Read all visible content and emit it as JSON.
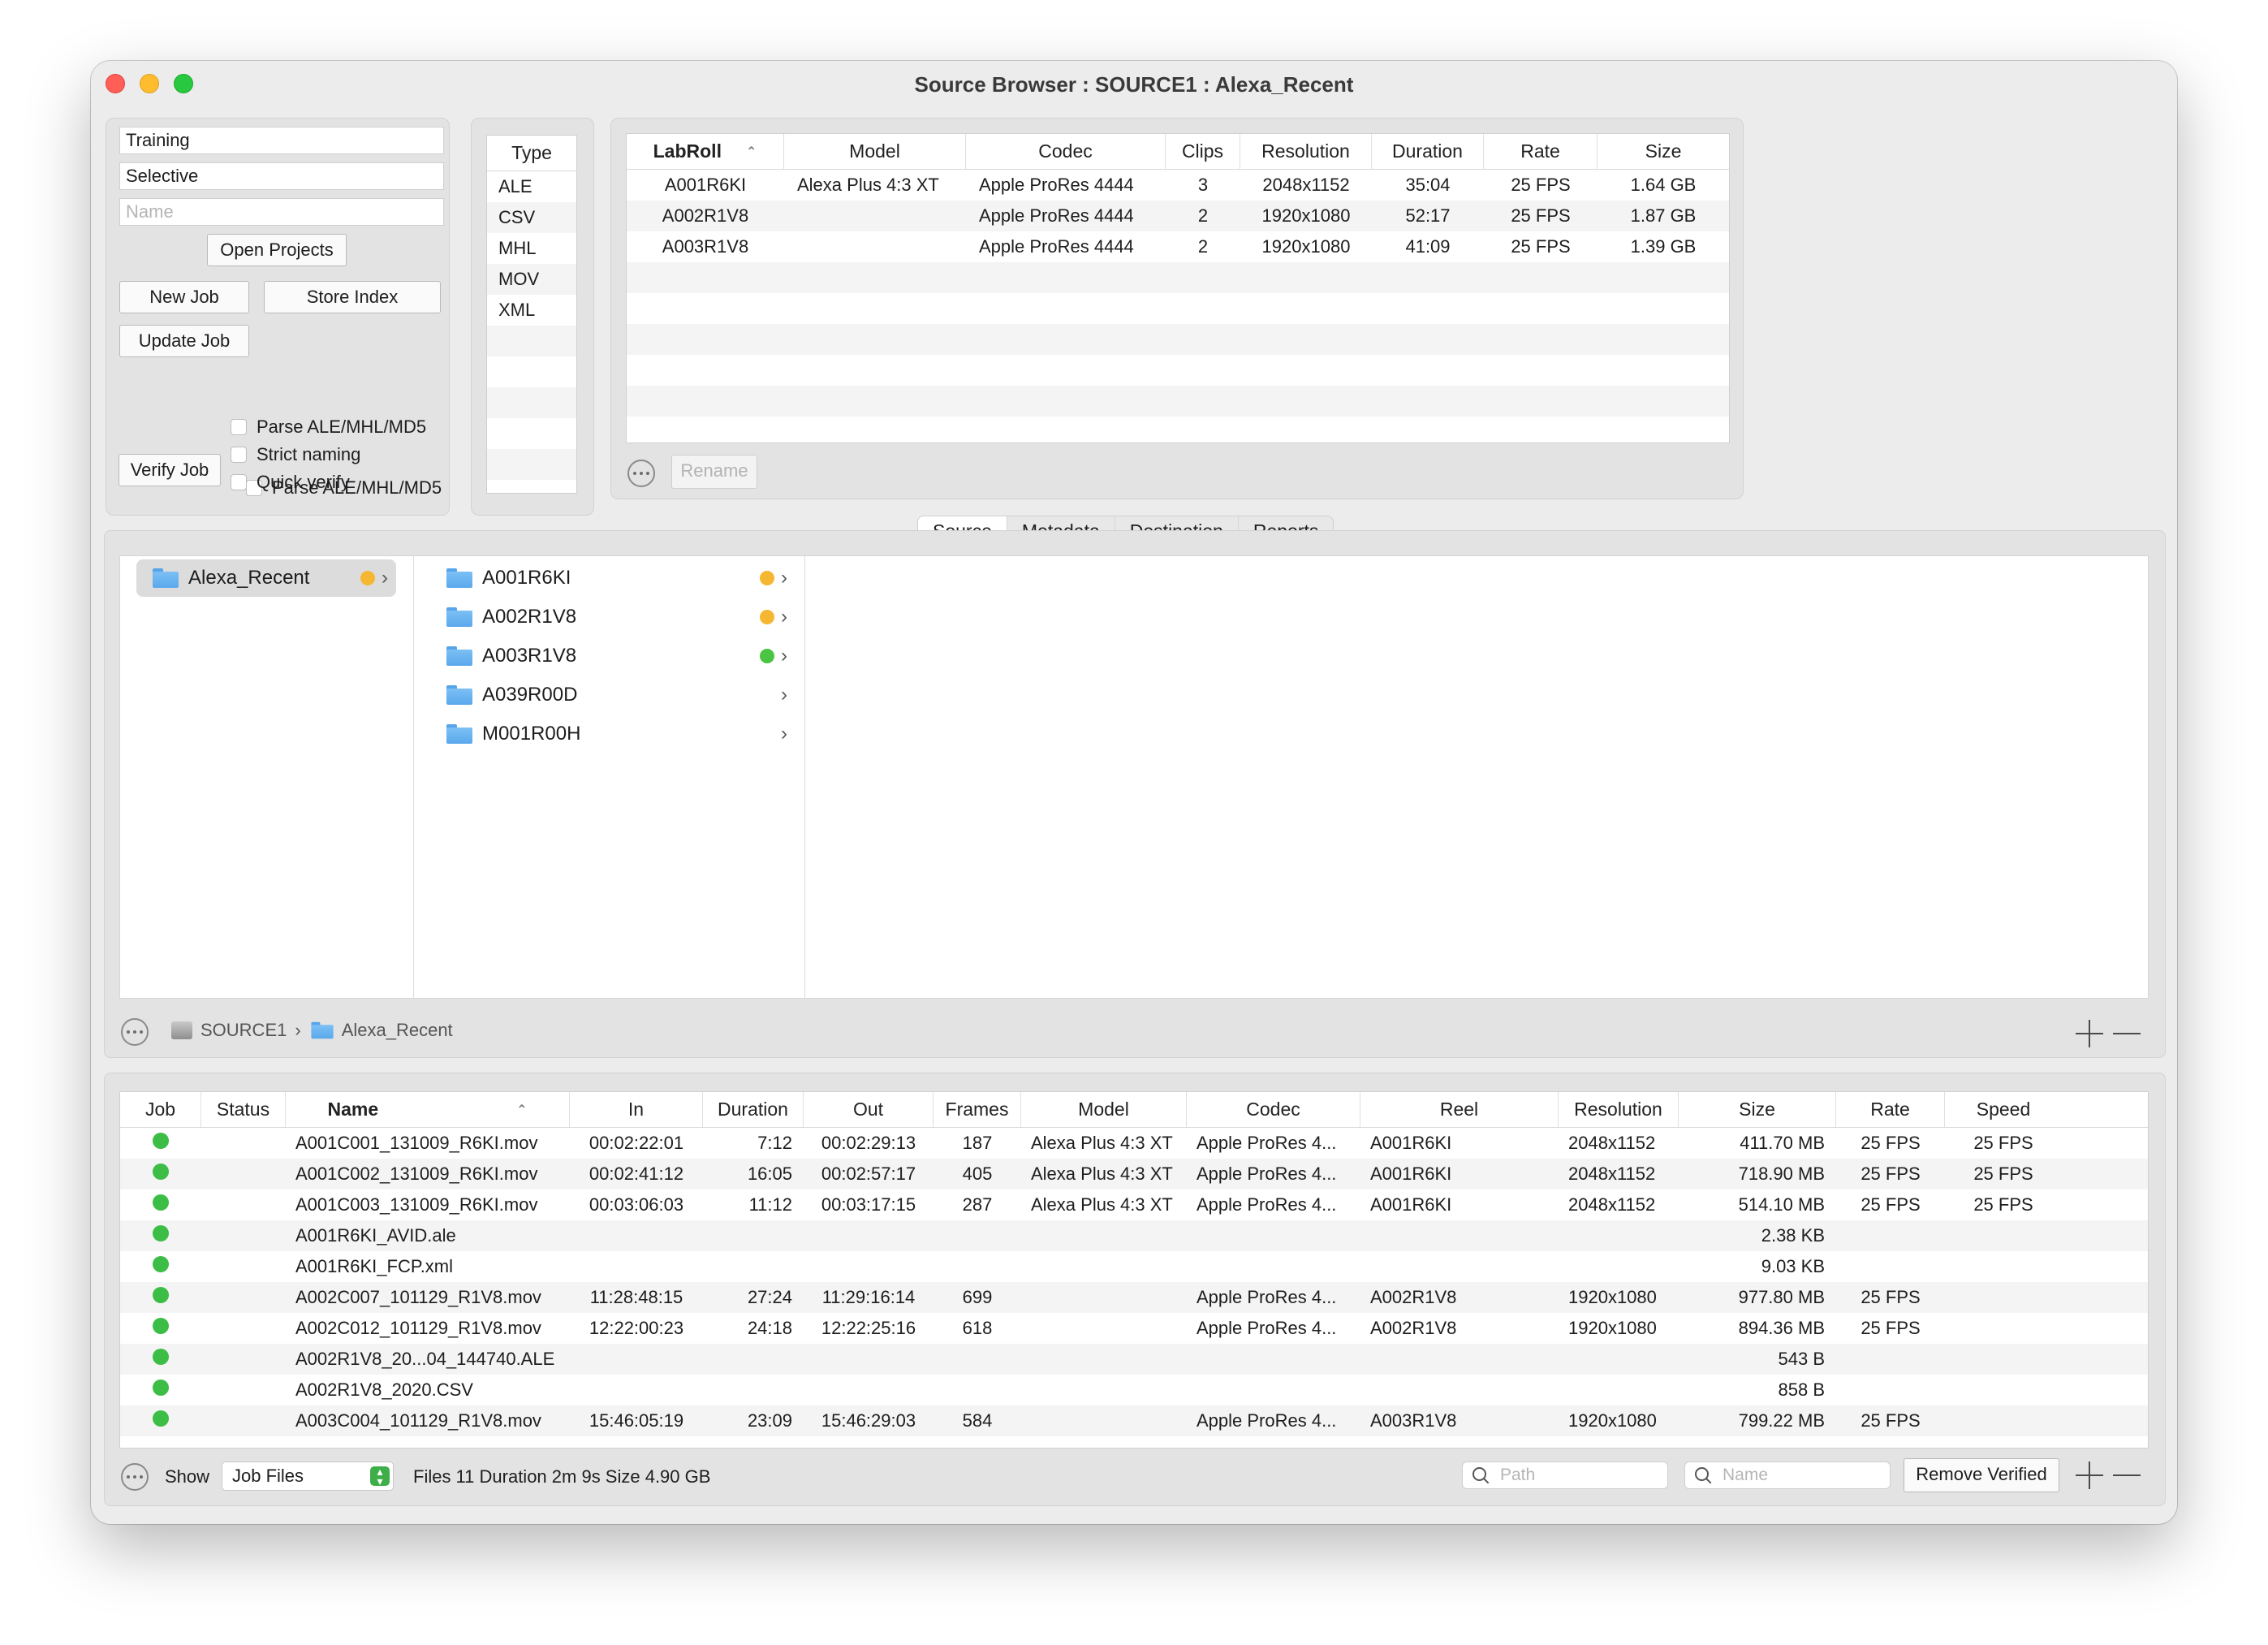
{
  "window": {
    "title": "Source Browser : SOURCE1 : Alexa_Recent"
  },
  "project": {
    "field1": "Training",
    "field2": "Selective",
    "name_placeholder": "Name",
    "open_projects": "Open Projects",
    "new_job": "New Job",
    "store_index": "Store Index",
    "update_job": "Update Job",
    "verify_job": "Verify Job",
    "options": [
      "Parse ALE/MHL/MD5",
      "Strict naming",
      "Quick verify"
    ]
  },
  "types": {
    "header": "Type",
    "items": [
      "ALE",
      "CSV",
      "MHL",
      "MOV",
      "XML"
    ]
  },
  "rolls": {
    "columns": [
      "LabRoll",
      "Model",
      "Codec",
      "Clips",
      "Resolution",
      "Duration",
      "Rate",
      "Size"
    ],
    "rows": [
      [
        "A001R6KI",
        "Alexa Plus 4:3 XT",
        "Apple ProRes 4444",
        "3",
        "2048x1152",
        "35:04",
        "25 FPS",
        "1.64 GB"
      ],
      [
        "A002R1V8",
        "",
        "Apple ProRes 4444",
        "2",
        "1920x1080",
        "52:17",
        "25 FPS",
        "1.87 GB"
      ],
      [
        "A003R1V8",
        "",
        "Apple ProRes 4444",
        "2",
        "1920x1080",
        "41:09",
        "25 FPS",
        "1.39 GB"
      ]
    ],
    "rename": "Rename"
  },
  "tabs": [
    "Source",
    "Metadata",
    "Destination",
    "Reports"
  ],
  "browser": {
    "root": "Alexa_Recent",
    "items": [
      {
        "name": "A001R6KI",
        "status": "orange"
      },
      {
        "name": "A002R1V8",
        "status": "orange"
      },
      {
        "name": "A003R1V8",
        "status": "green"
      },
      {
        "name": "A039R00D",
        "status": "none"
      },
      {
        "name": "M001R00H",
        "status": "none"
      }
    ],
    "path": [
      "SOURCE1",
      "Alexa_Recent"
    ],
    "path_sep": "›"
  },
  "files": {
    "columns": [
      "Job",
      "Status",
      "Name",
      "In",
      "Duration",
      "Out",
      "Frames",
      "Model",
      "Codec",
      "Reel",
      "Resolution",
      "Size",
      "Rate",
      "Speed"
    ],
    "rows": [
      [
        "A001C001_131009_R6KI.mov",
        "00:02:22:01",
        "7:12",
        "00:02:29:13",
        "187",
        "Alexa Plus 4:3 XT",
        "Apple ProRes 4...",
        "A001R6KI",
        "2048x1152",
        "411.70 MB",
        "25 FPS",
        "25 FPS"
      ],
      [
        "A001C002_131009_R6KI.mov",
        "00:02:41:12",
        "16:05",
        "00:02:57:17",
        "405",
        "Alexa Plus 4:3 XT",
        "Apple ProRes 4...",
        "A001R6KI",
        "2048x1152",
        "718.90 MB",
        "25 FPS",
        "25 FPS"
      ],
      [
        "A001C003_131009_R6KI.mov",
        "00:03:06:03",
        "11:12",
        "00:03:17:15",
        "287",
        "Alexa Plus 4:3 XT",
        "Apple ProRes 4...",
        "A001R6KI",
        "2048x1152",
        "514.10 MB",
        "25 FPS",
        "25 FPS"
      ],
      [
        "A001R6KI_AVID.ale",
        "",
        "",
        "",
        "",
        "",
        "",
        "",
        "",
        "2.38 KB",
        "",
        ""
      ],
      [
        "A001R6KI_FCP.xml",
        "",
        "",
        "",
        "",
        "",
        "",
        "",
        "",
        "9.03 KB",
        "",
        ""
      ],
      [
        "A002C007_101129_R1V8.mov",
        "11:28:48:15",
        "27:24",
        "11:29:16:14",
        "699",
        "",
        "Apple ProRes 4...",
        "A002R1V8",
        "1920x1080",
        "977.80 MB",
        "25 FPS",
        ""
      ],
      [
        "A002C012_101129_R1V8.mov",
        "12:22:00:23",
        "24:18",
        "12:22:25:16",
        "618",
        "",
        "Apple ProRes 4...",
        "A002R1V8",
        "1920x1080",
        "894.36 MB",
        "25 FPS",
        ""
      ],
      [
        "A002R1V8_20...04_144740.ALE",
        "",
        "",
        "",
        "",
        "",
        "",
        "",
        "",
        "543 B",
        "",
        ""
      ],
      [
        "A002R1V8_2020.CSV",
        "",
        "",
        "",
        "",
        "",
        "",
        "",
        "",
        "858 B",
        "",
        ""
      ],
      [
        "A003C004_101129_R1V8.mov",
        "15:46:05:19",
        "23:09",
        "15:46:29:03",
        "584",
        "",
        "Apple ProRes 4...",
        "A003R1V8",
        "1920x1080",
        "799.22 MB",
        "25 FPS",
        ""
      ]
    ]
  },
  "footer": {
    "show_label": "Show",
    "show_value": "Job Files",
    "summary": "Files 11 Duration 2m 9s Size 4.90 GB",
    "path_placeholder": "Path",
    "name_placeholder": "Name",
    "remove_verified": "Remove Verified"
  },
  "colors": {
    "status_orange": "#f5b731",
    "status_green": "#4cc443",
    "job_green": "#3cbd45"
  }
}
